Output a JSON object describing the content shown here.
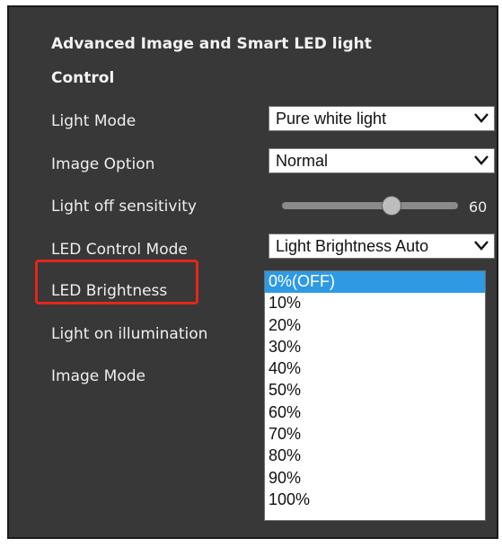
{
  "panel": {
    "title": "Advanced Image and Smart LED light Control"
  },
  "rows": {
    "light_mode": {
      "label": "Light Mode",
      "value": "Pure white light"
    },
    "image_option": {
      "label": "Image Option",
      "value": "Normal"
    },
    "light_off_sensitivity": {
      "label": "Light off sensitivity",
      "value": "60",
      "value_fraction": 0.62
    },
    "led_control_mode": {
      "label": "LED Control Mode",
      "value": "Light Brightness Auto"
    },
    "led_brightness": {
      "label": "LED Brightness"
    },
    "light_on_illumination": {
      "label": "Light on illumination"
    },
    "image_mode": {
      "label": "Image Mode"
    }
  },
  "brightness_dropdown": {
    "selected": "0%(OFF)",
    "options": [
      "0%(OFF)",
      "10%",
      "20%",
      "30%",
      "40%",
      "50%",
      "60%",
      "70%",
      "80%",
      "90%",
      "100%"
    ]
  },
  "colors": {
    "panel_bg": "#383838",
    "highlight_border": "#e5261b",
    "selected_option_bg": "#2f9ae3"
  },
  "icons": {
    "dropdown": "chevron-down-icon",
    "slider_thumb": "slider-thumb"
  }
}
